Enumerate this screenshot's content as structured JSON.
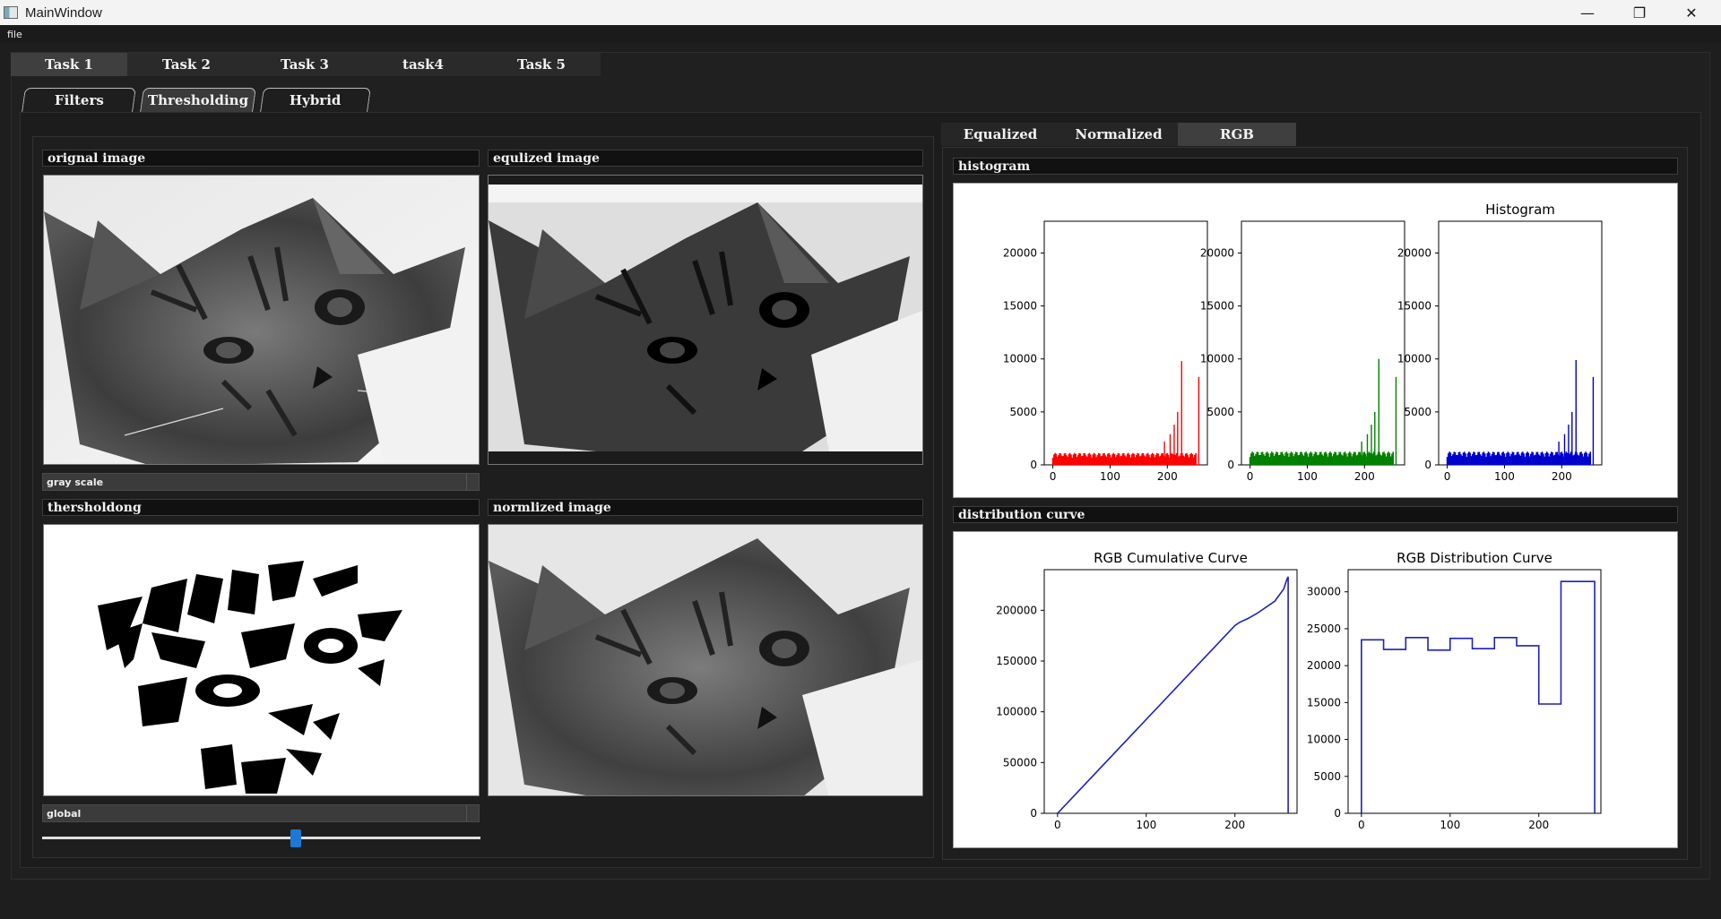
{
  "window": {
    "title": "MainWindow",
    "controls": {
      "minimize": "—",
      "restore": "❐",
      "close": "✕"
    }
  },
  "menubar": {
    "items": [
      "file"
    ]
  },
  "task_tabs": [
    "Task 1",
    "Task 2",
    "Task 3",
    "task4",
    "Task 5"
  ],
  "active_task_tab": "Task 1",
  "sub_tabs": [
    "Filters",
    "Thresholding",
    "Hybrid"
  ],
  "active_sub_tab": "Thresholding",
  "left_panel": {
    "original_label": "orignal image",
    "equalized_label": "equlized image",
    "gray_scale_combo": "gray scale",
    "thresholding_label": "thersholdong",
    "normalized_label": "normlized image",
    "threshold_combo": "global",
    "threshold_slider": {
      "value_fraction": 0.58,
      "handle_color": "#1f77d4"
    }
  },
  "plot_tabs": [
    "Equalized",
    "Normalized",
    "RGB"
  ],
  "active_plot_tab": "RGB",
  "histogram_panel": {
    "label": "histogram",
    "chart_data": [
      {
        "type": "bar",
        "title": "",
        "color": "#ff0000",
        "x_ticks": [
          "0",
          "100",
          "200"
        ],
        "y_ticks": [
          "0",
          "5000",
          "10000",
          "15000",
          "20000"
        ],
        "ylim": [
          0,
          23000
        ],
        "xlim": [
          -15,
          270
        ],
        "baseline_level": 900,
        "spikes": [
          [
            195,
            2200
          ],
          [
            205,
            2900
          ],
          [
            212,
            3800
          ],
          [
            218,
            5000
          ],
          [
            225,
            9800
          ],
          [
            255,
            8300
          ]
        ]
      },
      {
        "type": "bar",
        "title": "",
        "color": "#008000",
        "x_ticks": [
          "0",
          "100",
          "200"
        ],
        "y_ticks": [
          "0",
          "5000",
          "10000",
          "15000",
          "20000"
        ],
        "ylim": [
          0,
          23000
        ],
        "xlim": [
          -15,
          270
        ],
        "baseline_level": 1000,
        "spikes": [
          [
            195,
            2200
          ],
          [
            205,
            2900
          ],
          [
            212,
            3800
          ],
          [
            218,
            5000
          ],
          [
            225,
            10000
          ],
          [
            255,
            8300
          ]
        ]
      },
      {
        "type": "bar",
        "title": "Histogram",
        "color": "#0000cc",
        "x_ticks": [
          "0",
          "100",
          "200"
        ],
        "y_ticks": [
          "0",
          "5000",
          "10000",
          "15000",
          "20000"
        ],
        "ylim": [
          0,
          23000
        ],
        "xlim": [
          -15,
          270
        ],
        "baseline_level": 1000,
        "spikes": [
          [
            195,
            2200
          ],
          [
            205,
            2900
          ],
          [
            212,
            3800
          ],
          [
            218,
            5000
          ],
          [
            225,
            9900
          ],
          [
            255,
            8300
          ]
        ]
      }
    ]
  },
  "distribution_panel": {
    "label": "distribution curve",
    "chart_data": [
      {
        "type": "line",
        "title": "RGB Cumulative Curve",
        "color": "#1f1fbf",
        "x_ticks": [
          "0",
          "100",
          "200"
        ],
        "y_ticks": [
          "0",
          "50000",
          "100000",
          "150000",
          "200000"
        ],
        "xlim": [
          -15,
          270
        ],
        "ylim": [
          0,
          240000
        ],
        "x": [
          0,
          200,
          205,
          215,
          225,
          245,
          255,
          258,
          260
        ],
        "y": [
          0,
          185000,
          188000,
          192000,
          197000,
          209000,
          221000,
          229000,
          233000
        ]
      },
      {
        "type": "line",
        "title": "RGB Distribution Curve",
        "color": "#1f1fbf",
        "x_ticks": [
          "0",
          "100",
          "200"
        ],
        "y_ticks": [
          "0",
          "5000",
          "10000",
          "15000",
          "20000",
          "25000",
          "30000"
        ],
        "xlim": [
          -15,
          270
        ],
        "ylim": [
          0,
          33000
        ],
        "x": [
          0,
          25,
          50,
          75,
          100,
          125,
          150,
          175,
          200,
          225,
          255
        ],
        "y": [
          23500,
          22200,
          23800,
          22100,
          23700,
          22300,
          23800,
          22700,
          14800,
          31400,
          31400
        ]
      }
    ]
  }
}
